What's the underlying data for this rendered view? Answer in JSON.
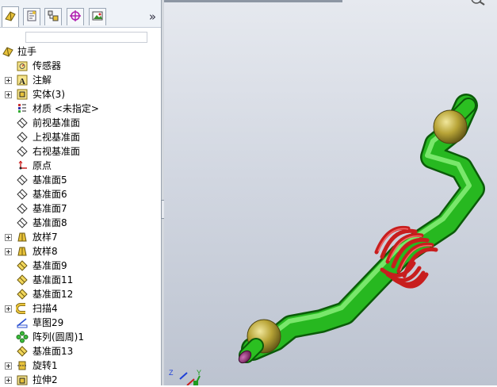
{
  "feature_manager": {
    "tabs": [
      {
        "name": "featuremanager-tab-icon",
        "active": true
      },
      {
        "name": "propertymanager-tab-icon",
        "active": false
      },
      {
        "name": "configurationmanager-tab-icon",
        "active": false
      },
      {
        "name": "dimxpert-tab-icon",
        "active": false
      },
      {
        "name": "display-manager-tab-icon",
        "active": false
      }
    ],
    "more_label": "»",
    "tree": [
      {
        "label": "拉手",
        "icon": "part-icon",
        "expandable": false,
        "level": 0
      },
      {
        "label": "传感器",
        "icon": "sensors-icon",
        "expandable": false,
        "level": 1
      },
      {
        "label": "注解",
        "icon": "annotations-icon",
        "expandable": true,
        "level": 1
      },
      {
        "label": "实体(3)",
        "icon": "solid-bodies-icon",
        "expandable": true,
        "level": 1
      },
      {
        "label": "材质 <未指定>",
        "icon": "material-icon",
        "expandable": false,
        "level": 1
      },
      {
        "label": "前视基准面",
        "icon": "plane-icon",
        "expandable": false,
        "level": 1
      },
      {
        "label": "上视基准面",
        "icon": "plane-icon",
        "expandable": false,
        "level": 1
      },
      {
        "label": "右视基准面",
        "icon": "plane-icon",
        "expandable": false,
        "level": 1
      },
      {
        "label": "原点",
        "icon": "origin-icon",
        "expandable": false,
        "level": 1
      },
      {
        "label": "基准面5",
        "icon": "plane-icon",
        "expandable": false,
        "level": 1
      },
      {
        "label": "基准面6",
        "icon": "plane-icon",
        "expandable": false,
        "level": 1
      },
      {
        "label": "基准面7",
        "icon": "plane-icon",
        "expandable": false,
        "level": 1
      },
      {
        "label": "基准面8",
        "icon": "plane-icon",
        "expandable": false,
        "level": 1
      },
      {
        "label": "放样7",
        "icon": "loft-icon",
        "expandable": true,
        "level": 1
      },
      {
        "label": "放样8",
        "icon": "loft-icon",
        "expandable": true,
        "level": 1
      },
      {
        "label": "基准面9",
        "icon": "plane-yellow-icon",
        "expandable": false,
        "level": 1
      },
      {
        "label": "基准面11",
        "icon": "plane-yellow-icon",
        "expandable": false,
        "level": 1
      },
      {
        "label": "基准面12",
        "icon": "plane-yellow-icon",
        "expandable": false,
        "level": 1
      },
      {
        "label": "扫描4",
        "icon": "sweep-icon",
        "expandable": true,
        "level": 1
      },
      {
        "label": "草图29",
        "icon": "sketch-icon",
        "expandable": false,
        "level": 1
      },
      {
        "label": "阵列(圆周)1",
        "icon": "circular-pattern-icon",
        "expandable": false,
        "level": 1
      },
      {
        "label": "基准面13",
        "icon": "plane-yellow-icon",
        "expandable": false,
        "level": 1
      },
      {
        "label": "旋转1",
        "icon": "revolve-icon",
        "expandable": true,
        "level": 1
      },
      {
        "label": "拉伸2",
        "icon": "extrude-icon",
        "expandable": true,
        "level": 1
      }
    ]
  },
  "viewport": {
    "triad": {
      "x_label": "Y",
      "y_label": "",
      "z_label": "Z"
    },
    "model_colors": {
      "handle": "#22b21d",
      "knob": "#b8a437",
      "spring": "#c81e1e",
      "end_cap": "#8a2466"
    }
  }
}
